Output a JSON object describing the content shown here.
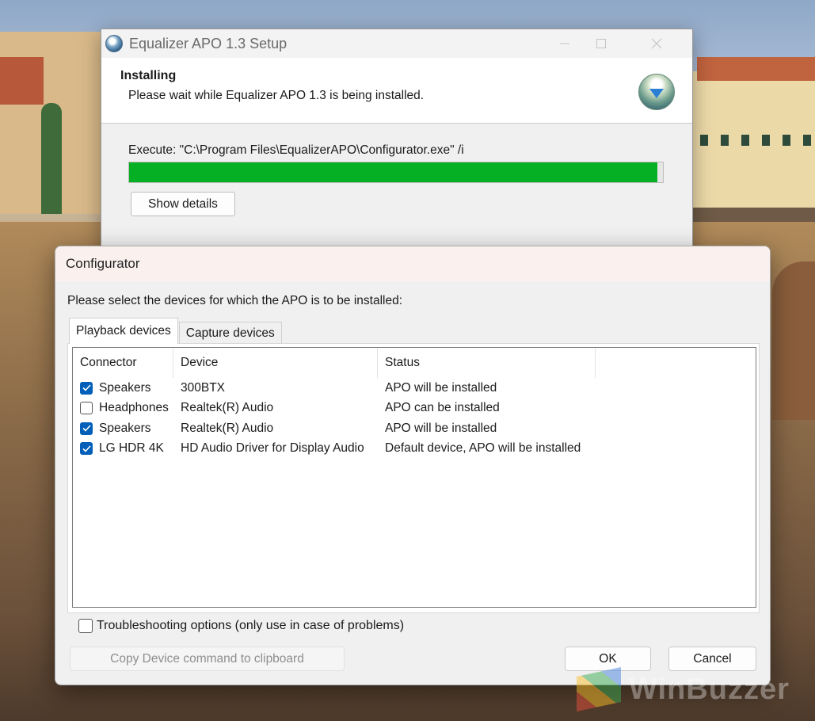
{
  "installer": {
    "title": "Equalizer APO 1.3 Setup",
    "header_title": "Installing",
    "header_subtitle": "Please wait while Equalizer APO 1.3 is being installed.",
    "execute_text": "Execute: \"C:\\Program Files\\EqualizerAPO\\Configurator.exe\" /i",
    "progress": 0.99,
    "show_details_label": "Show details",
    "accent_color": "#06b025"
  },
  "configurator": {
    "title": "Configurator",
    "prompt": "Please select the devices for which the APO is to be installed:",
    "tabs": [
      {
        "label": "Playback devices",
        "active": true
      },
      {
        "label": "Capture devices",
        "active": false
      }
    ],
    "columns": [
      "Connector",
      "Device",
      "Status"
    ],
    "rows": [
      {
        "checked": true,
        "connector": "Speakers",
        "device": "300BTX",
        "status": "APO will be installed"
      },
      {
        "checked": false,
        "connector": "Headphones",
        "device": "Realtek(R) Audio",
        "status": "APO can be installed"
      },
      {
        "checked": true,
        "connector": "Speakers",
        "device": "Realtek(R) Audio",
        "status": "APO will be installed"
      },
      {
        "checked": true,
        "connector": "LG HDR 4K",
        "device": "HD Audio Driver for Display Audio",
        "status": "Default device, APO will be installed"
      }
    ],
    "troubleshooting_label": "Troubleshooting options (only use in case of problems)",
    "troubleshooting_checked": false,
    "copy_button": "Copy Device command to clipboard",
    "ok_button": "OK",
    "cancel_button": "Cancel",
    "checkbox_color": "#005fb8"
  },
  "watermark": "WinBuzzer"
}
